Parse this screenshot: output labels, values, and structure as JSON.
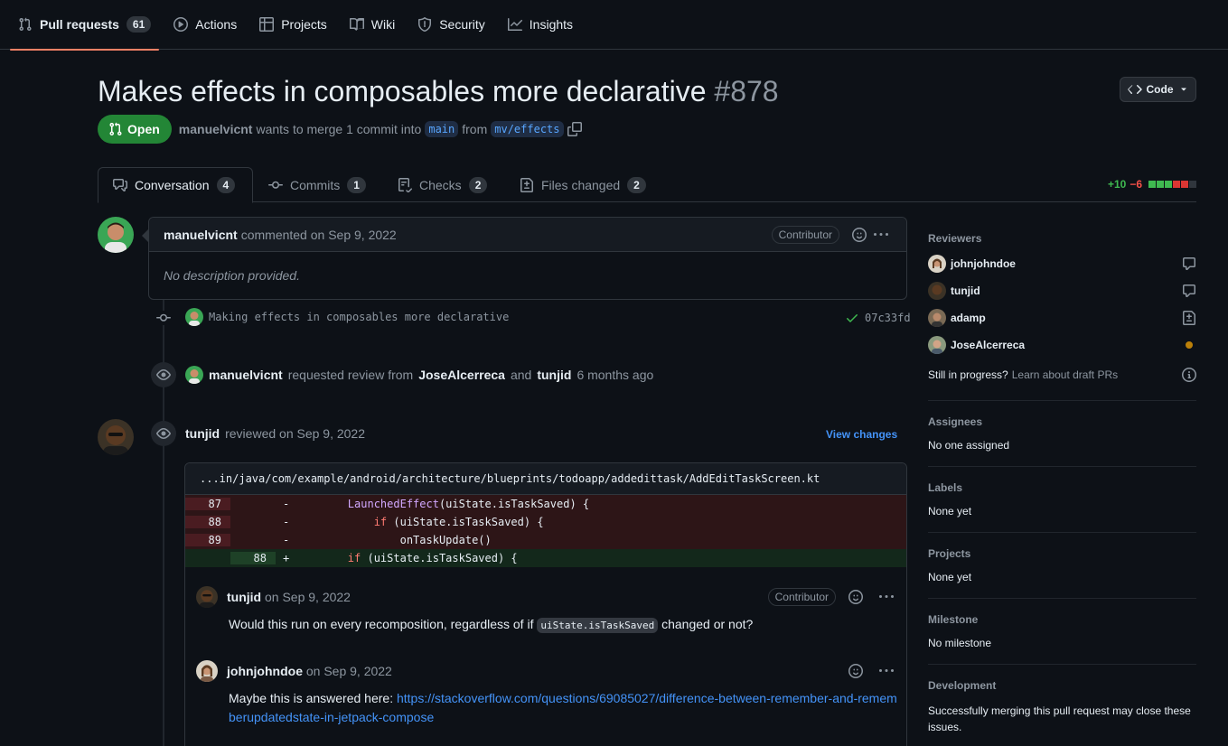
{
  "nav": {
    "items": [
      {
        "label": "Pull requests",
        "count": "61",
        "icon": "git-pull-request-icon"
      },
      {
        "label": "Actions",
        "icon": "play-icon"
      },
      {
        "label": "Projects",
        "icon": "table-icon"
      },
      {
        "label": "Wiki",
        "icon": "book-icon"
      },
      {
        "label": "Security",
        "icon": "shield-icon"
      },
      {
        "label": "Insights",
        "icon": "graph-icon"
      }
    ]
  },
  "pr": {
    "title": "Makes effects in composables more declarative",
    "number": "#878",
    "state": "Open",
    "author": "manuelvicnt",
    "merge_text": "wants to merge 1 commit into",
    "base_branch": "main",
    "from_text": "from",
    "head_branch": "mv/effects",
    "code_button": "Code"
  },
  "tabs": [
    {
      "label": "Conversation",
      "count": "4"
    },
    {
      "label": "Commits",
      "count": "1"
    },
    {
      "label": "Checks",
      "count": "2"
    },
    {
      "label": "Files changed",
      "count": "2"
    }
  ],
  "diffstat": {
    "additions": "+10",
    "deletions": "−6",
    "blocks": [
      "add",
      "add",
      "add",
      "del",
      "del",
      "neutral"
    ],
    "colors": {
      "add": "#3fb950",
      "del": "#da3633",
      "neutral": "#30363d"
    }
  },
  "first_comment": {
    "author": "manuelvicnt",
    "action": "commented on Sep 9, 2022",
    "role": "Contributor",
    "body": "No description provided."
  },
  "commit": {
    "message": "Making effects in composables more declarative",
    "sha": "07c33fd"
  },
  "review_request": {
    "author": "manuelvicnt",
    "text1": "requested review from",
    "reviewer1": "JoseAlcerreca",
    "and": "and",
    "reviewer2": "tunjid",
    "time": "6 months ago"
  },
  "review": {
    "author": "tunjid",
    "action": "reviewed on Sep 9, 2022",
    "view_changes": "View changes",
    "file_path": "...in/java/com/example/android/architecture/blueprints/todoapp/addedittask/AddEditTaskScreen.kt",
    "diff": [
      {
        "type": "del",
        "old": "87",
        "new": "",
        "sign": "-",
        "indent": "        ",
        "parts": [
          {
            "t": "LaunchedEffect",
            "c": "fn"
          },
          {
            "t": "(uiState.isTaskSaved) {",
            "c": ""
          }
        ]
      },
      {
        "type": "del",
        "old": "88",
        "new": "",
        "sign": "-",
        "indent": "            ",
        "parts": [
          {
            "t": "if",
            "c": "kw"
          },
          {
            "t": " (uiState.isTaskSaved) {",
            "c": ""
          }
        ]
      },
      {
        "type": "del",
        "old": "89",
        "new": "",
        "sign": "-",
        "indent": "                ",
        "parts": [
          {
            "t": "onTaskUpdate()",
            "c": ""
          }
        ]
      },
      {
        "type": "add",
        "old": "",
        "new": "88",
        "sign": "+",
        "indent": "        ",
        "parts": [
          {
            "t": "if",
            "c": "kw"
          },
          {
            "t": " (uiState.isTaskSaved) {",
            "c": ""
          }
        ]
      }
    ],
    "replies": [
      {
        "author": "tunjid",
        "time": "on Sep 9, 2022",
        "role": "Contributor",
        "body_before": "Would this run on every recomposition, regardless of if",
        "code": "uiState.isTaskSaved",
        "body_after": "changed or not?"
      },
      {
        "author": "johnjohndoe",
        "time": "on Sep 9, 2022",
        "body_before": "Maybe this is answered here:",
        "link": "https://stackoverflow.com/questions/69085027/difference-between-remember-and-rememberupdatedstate-in-jetpack-compose"
      }
    ]
  },
  "sidebar": {
    "reviewers_title": "Reviewers",
    "reviewers": [
      {
        "name": "johnjohndoe",
        "status_icon": "comment-icon"
      },
      {
        "name": "tunjid",
        "status_icon": "comment-icon"
      },
      {
        "name": "adamp",
        "status_icon": "file-diff-icon"
      },
      {
        "name": "JoseAlcerreca",
        "status_icon": "pending-dot"
      }
    ],
    "draft_question": "Still in progress?",
    "draft_link": "Learn about draft PRs",
    "assignees_title": "Assignees",
    "assignees_value": "No one assigned",
    "labels_title": "Labels",
    "labels_value": "None yet",
    "projects_title": "Projects",
    "projects_value": "None yet",
    "milestone_title": "Milestone",
    "milestone_value": "No milestone",
    "development_title": "Development",
    "development_value": "Successfully merging this pull request may close these issues."
  }
}
